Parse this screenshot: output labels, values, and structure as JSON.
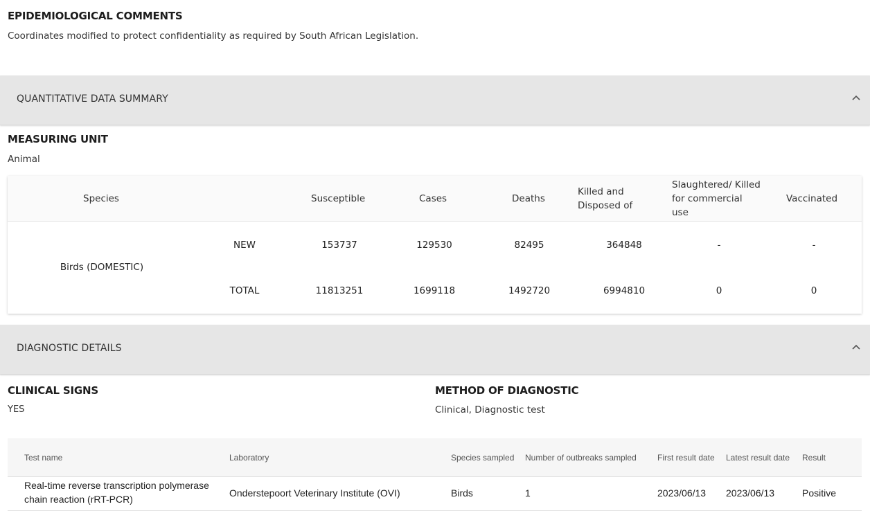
{
  "epidemiological": {
    "title": "EPIDEMIOLOGICAL COMMENTS",
    "text": "Coordinates modified to protect confidentiality as required by South African Legislation."
  },
  "quantitative": {
    "accordion_label": "QUANTITATIVE DATA SUMMARY",
    "chevron_icon": "chevron-up-icon",
    "measuring_unit_title": "MEASURING UNIT",
    "measuring_unit_value": "Animal",
    "headers": {
      "species": "Species",
      "susceptible": "Susceptible",
      "cases": "Cases",
      "deaths": "Deaths",
      "killed_line1": "Killed and",
      "killed_line2": "Disposed of",
      "slaughtered_line1": "Slaughtered/ Killed",
      "slaughtered_line2": "for commercial",
      "slaughtered_line3": "use",
      "vaccinated": "Vaccinated"
    },
    "species_name": "Birds (DOMESTIC)",
    "rows": [
      {
        "label": "NEW",
        "susceptible": "153737",
        "cases": "129530",
        "deaths": "82495",
        "killed": "364848",
        "slaughtered": "-",
        "vaccinated": "-"
      },
      {
        "label": "TOTAL",
        "susceptible": "11813251",
        "cases": "1699118",
        "deaths": "1492720",
        "killed": "6994810",
        "slaughtered": "0",
        "vaccinated": "0"
      }
    ]
  },
  "diagnostic": {
    "accordion_label": "DIAGNOSTIC DETAILS",
    "chevron_icon": "chevron-up-icon",
    "clinical_signs_title": "CLINICAL SIGNS",
    "clinical_signs_value": "YES",
    "method_title": "METHOD OF DIAGNOSTIC",
    "method_value": "Clinical, Diagnostic test",
    "table_headers": {
      "test_name": "Test name",
      "laboratory": "Laboratory",
      "species_sampled": "Species sampled",
      "outbreaks_sampled": "Number of outbreaks sampled",
      "first_result": "First result date",
      "latest_result": "Latest result date",
      "result": "Result"
    },
    "tests": [
      {
        "test_name_line1": "Real-time reverse transcription polymerase",
        "test_name_line2": "chain reaction (rRT-PCR)",
        "laboratory": "Onderstepoort Veterinary Institute (OVI)",
        "species_sampled": "Birds",
        "outbreaks_sampled": "1",
        "first_result": "2023/06/13",
        "latest_result": "2023/06/13",
        "result": "Positive"
      }
    ]
  }
}
